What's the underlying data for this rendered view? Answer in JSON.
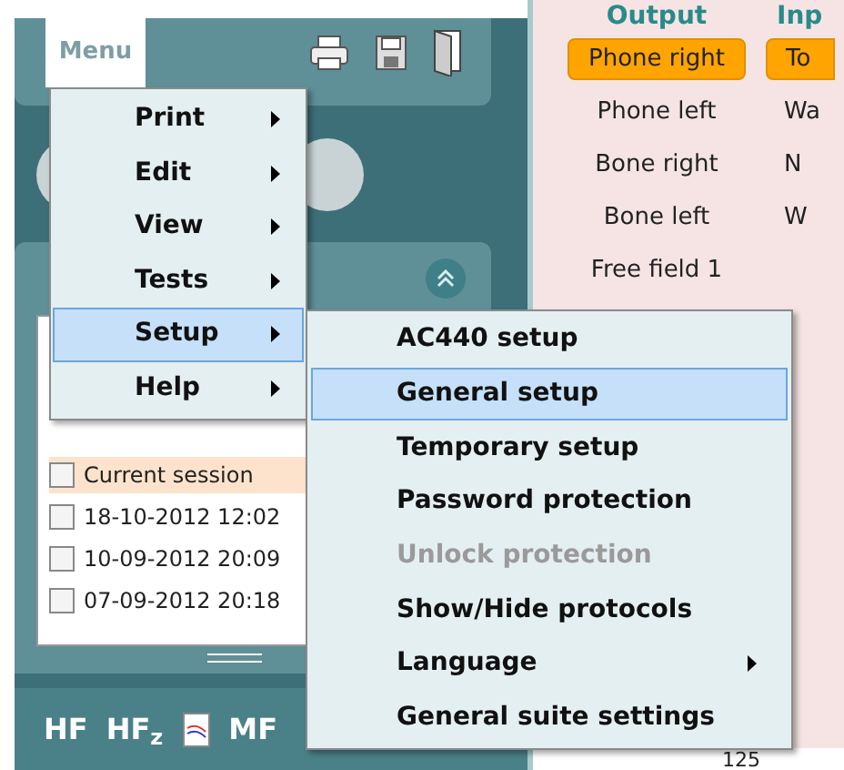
{
  "app_menu": {
    "label": "Menu"
  },
  "output": {
    "heading": "Output",
    "items": [
      {
        "label": "Phone right",
        "selected": true
      },
      {
        "label": "Phone left",
        "selected": false
      },
      {
        "label": "Bone right",
        "selected": false
      },
      {
        "label": "Bone left",
        "selected": false
      },
      {
        "label": "Free field 1",
        "selected": false
      }
    ]
  },
  "input": {
    "heading": "Inp",
    "items": [
      {
        "label": "To",
        "selected": true
      },
      {
        "label": "Wa",
        "selected": false
      },
      {
        "label": "N",
        "selected": false
      },
      {
        "label": "W",
        "selected": false
      }
    ]
  },
  "sessions": {
    "items": [
      {
        "label": "Current session",
        "current": true,
        "checked": false
      },
      {
        "label": "18-10-2012 12:02",
        "current": false,
        "checked": false
      },
      {
        "label": "10-09-2012 20:09",
        "current": false,
        "checked": false
      },
      {
        "label": "07-09-2012 20:18",
        "current": false,
        "checked": false
      }
    ]
  },
  "toolbar": [
    {
      "kind": "text",
      "label": "HF"
    },
    {
      "kind": "text",
      "label": "HF$_{z}$"
    },
    {
      "kind": "icon"
    },
    {
      "kind": "text",
      "label": "MF"
    }
  ],
  "menu": {
    "items": [
      {
        "label": "Print",
        "submenu": true,
        "selected": false
      },
      {
        "label": "Edit",
        "submenu": true,
        "selected": false
      },
      {
        "label": "View",
        "submenu": true,
        "selected": false
      },
      {
        "label": "Tests",
        "submenu": true,
        "selected": false
      },
      {
        "label": "Setup",
        "submenu": true,
        "selected": true
      },
      {
        "label": "Help",
        "submenu": true,
        "selected": false
      }
    ]
  },
  "submenu": {
    "items": [
      {
        "label": "AC440 setup",
        "selected": false,
        "disabled": false,
        "submenu": false
      },
      {
        "label": "General setup",
        "selected": true,
        "disabled": false,
        "submenu": false
      },
      {
        "label": "Temporary setup",
        "selected": false,
        "disabled": false,
        "submenu": false
      },
      {
        "label": "Password protection",
        "selected": false,
        "disabled": false,
        "submenu": false
      },
      {
        "label": "Unlock protection",
        "selected": false,
        "disabled": true,
        "submenu": false
      },
      {
        "label": "Show/Hide protocols",
        "selected": false,
        "disabled": false,
        "submenu": false
      },
      {
        "label": "Language",
        "selected": false,
        "disabled": false,
        "submenu": true
      },
      {
        "label": "General suite settings",
        "selected": false,
        "disabled": false,
        "submenu": false
      }
    ]
  },
  "scale_label": "125"
}
